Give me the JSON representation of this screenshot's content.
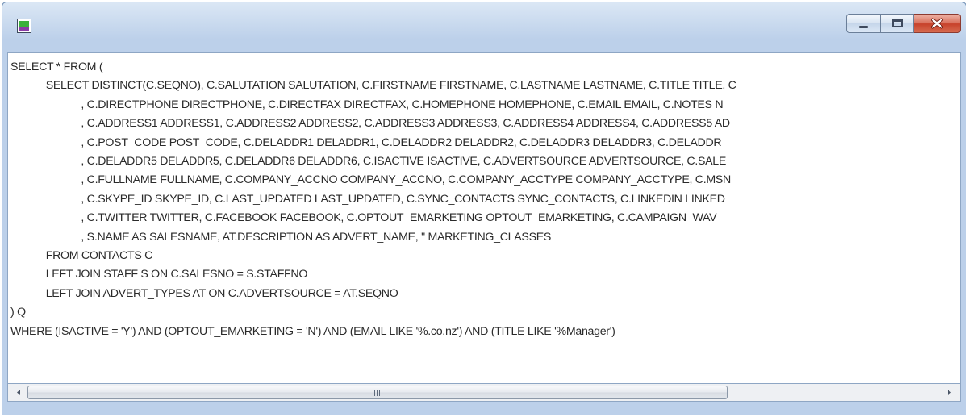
{
  "window": {
    "icon": "app-icon",
    "controls": {
      "minimize": "minimize-icon",
      "maximize": "maximize-icon",
      "close": "close-icon"
    }
  },
  "editor": {
    "lines": [
      "SELECT * FROM (",
      "            SELECT DISTINCT(C.SEQNO), C.SALUTATION SALUTATION, C.FIRSTNAME FIRSTNAME, C.LASTNAME LASTNAME, C.TITLE TITLE, C",
      "                        , C.DIRECTPHONE DIRECTPHONE, C.DIRECTFAX DIRECTFAX, C.HOMEPHONE HOMEPHONE, C.EMAIL EMAIL, C.NOTES N",
      "                        , C.ADDRESS1 ADDRESS1, C.ADDRESS2 ADDRESS2, C.ADDRESS3 ADDRESS3, C.ADDRESS4 ADDRESS4, C.ADDRESS5 AD",
      "                        , C.POST_CODE POST_CODE, C.DELADDR1 DELADDR1, C.DELADDR2 DELADDR2, C.DELADDR3 DELADDR3, C.DELADDR",
      "                        , C.DELADDR5 DELADDR5, C.DELADDR6 DELADDR6, C.ISACTIVE ISACTIVE, C.ADVERTSOURCE ADVERTSOURCE, C.SALE",
      "                        , C.FULLNAME FULLNAME, C.COMPANY_ACCNO COMPANY_ACCNO, C.COMPANY_ACCTYPE COMPANY_ACCTYPE, C.MSN",
      "                        , C.SKYPE_ID SKYPE_ID, C.LAST_UPDATED LAST_UPDATED, C.SYNC_CONTACTS SYNC_CONTACTS, C.LINKEDIN LINKED",
      "                        , C.TWITTER TWITTER, C.FACEBOOK FACEBOOK, C.OPTOUT_EMARKETING OPTOUT_EMARKETING, C.CAMPAIGN_WAV",
      "                        , S.NAME AS SALESNAME, AT.DESCRIPTION AS ADVERT_NAME, '' MARKETING_CLASSES",
      "            FROM CONTACTS C",
      "            LEFT JOIN STAFF S ON C.SALESNO = S.STAFFNO",
      "            LEFT JOIN ADVERT_TYPES AT ON C.ADVERTSOURCE = AT.SEQNO",
      ") Q",
      "WHERE (ISACTIVE = 'Y') AND (OPTOUT_EMARKETING = 'N') AND (EMAIL LIKE '%.co.nz') AND (TITLE LIKE '%Manager')"
    ]
  },
  "scrollbar": {
    "grip_label": "III",
    "position": 0.0,
    "left_arrow": "scroll-left-icon",
    "right_arrow": "scroll-right-icon"
  }
}
